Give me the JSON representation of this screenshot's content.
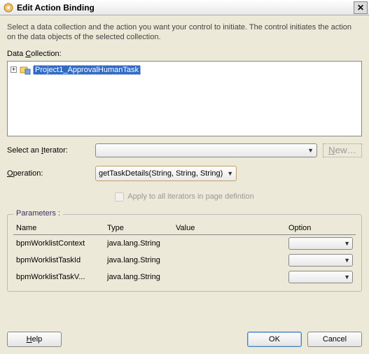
{
  "window": {
    "title": "Edit Action Binding"
  },
  "description": "Select a data collection and the action you want your control to initiate. The control initiates the action on the data objects of the selected collection.",
  "labels": {
    "dataCollection": {
      "pre": "Data ",
      "u": "C",
      "post": "ollection:"
    },
    "selectIterator": {
      "pre": "Select an ",
      "u": "I",
      "post": "terator:"
    },
    "operation": {
      "u": "O",
      "post": "peration:"
    },
    "newBtn": {
      "u": "N",
      "post": "ew…"
    },
    "applyAll": "Apply to all iterators in page defintion",
    "parameters": "Parameters :",
    "help": {
      "u": "H",
      "post": "elp"
    },
    "ok": "OK",
    "cancel": "Cancel"
  },
  "tree": {
    "root": "Project1_ApprovalHumanTask"
  },
  "iterator": {
    "value": ""
  },
  "operation": {
    "value": "getTaskDetails(String, String, String)"
  },
  "paramHeaders": {
    "name": "Name",
    "type": "Type",
    "value": "Value",
    "option": "Option"
  },
  "params": [
    {
      "name": "bpmWorklistContext",
      "type": "java.lang.String",
      "value": "",
      "option": ""
    },
    {
      "name": "bpmWorklistTaskId",
      "type": "java.lang.String",
      "value": "",
      "option": ""
    },
    {
      "name": "bpmWorklistTaskV...",
      "type": "java.lang.String",
      "value": "",
      "option": ""
    }
  ]
}
